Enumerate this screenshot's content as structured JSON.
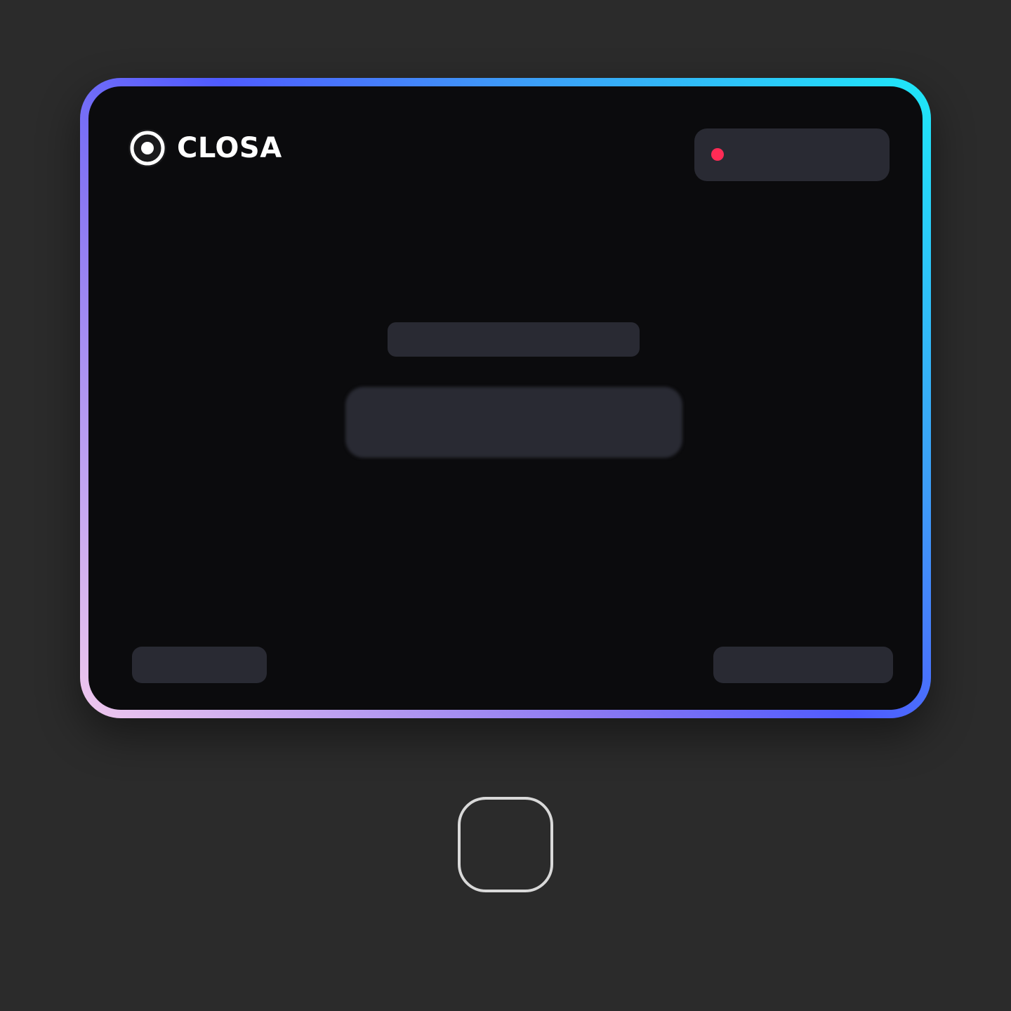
{
  "brand": {
    "name": "CLOSA",
    "icon": "target-icon"
  },
  "status": {
    "label": "",
    "dot_color": "#ff2b55"
  },
  "main": {
    "heading": "",
    "button_label": ""
  },
  "footer": {
    "left_label": "",
    "right_label": ""
  },
  "colors": {
    "background": "#2b2b2b",
    "card": "#0b0b0d",
    "placeholder": "#292a33",
    "gradient": [
      "#f0c8ee",
      "#8a78f2",
      "#4f5bff",
      "#3d9cf7",
      "#1ee8f8"
    ]
  },
  "device": {
    "home_button": "home-button"
  }
}
